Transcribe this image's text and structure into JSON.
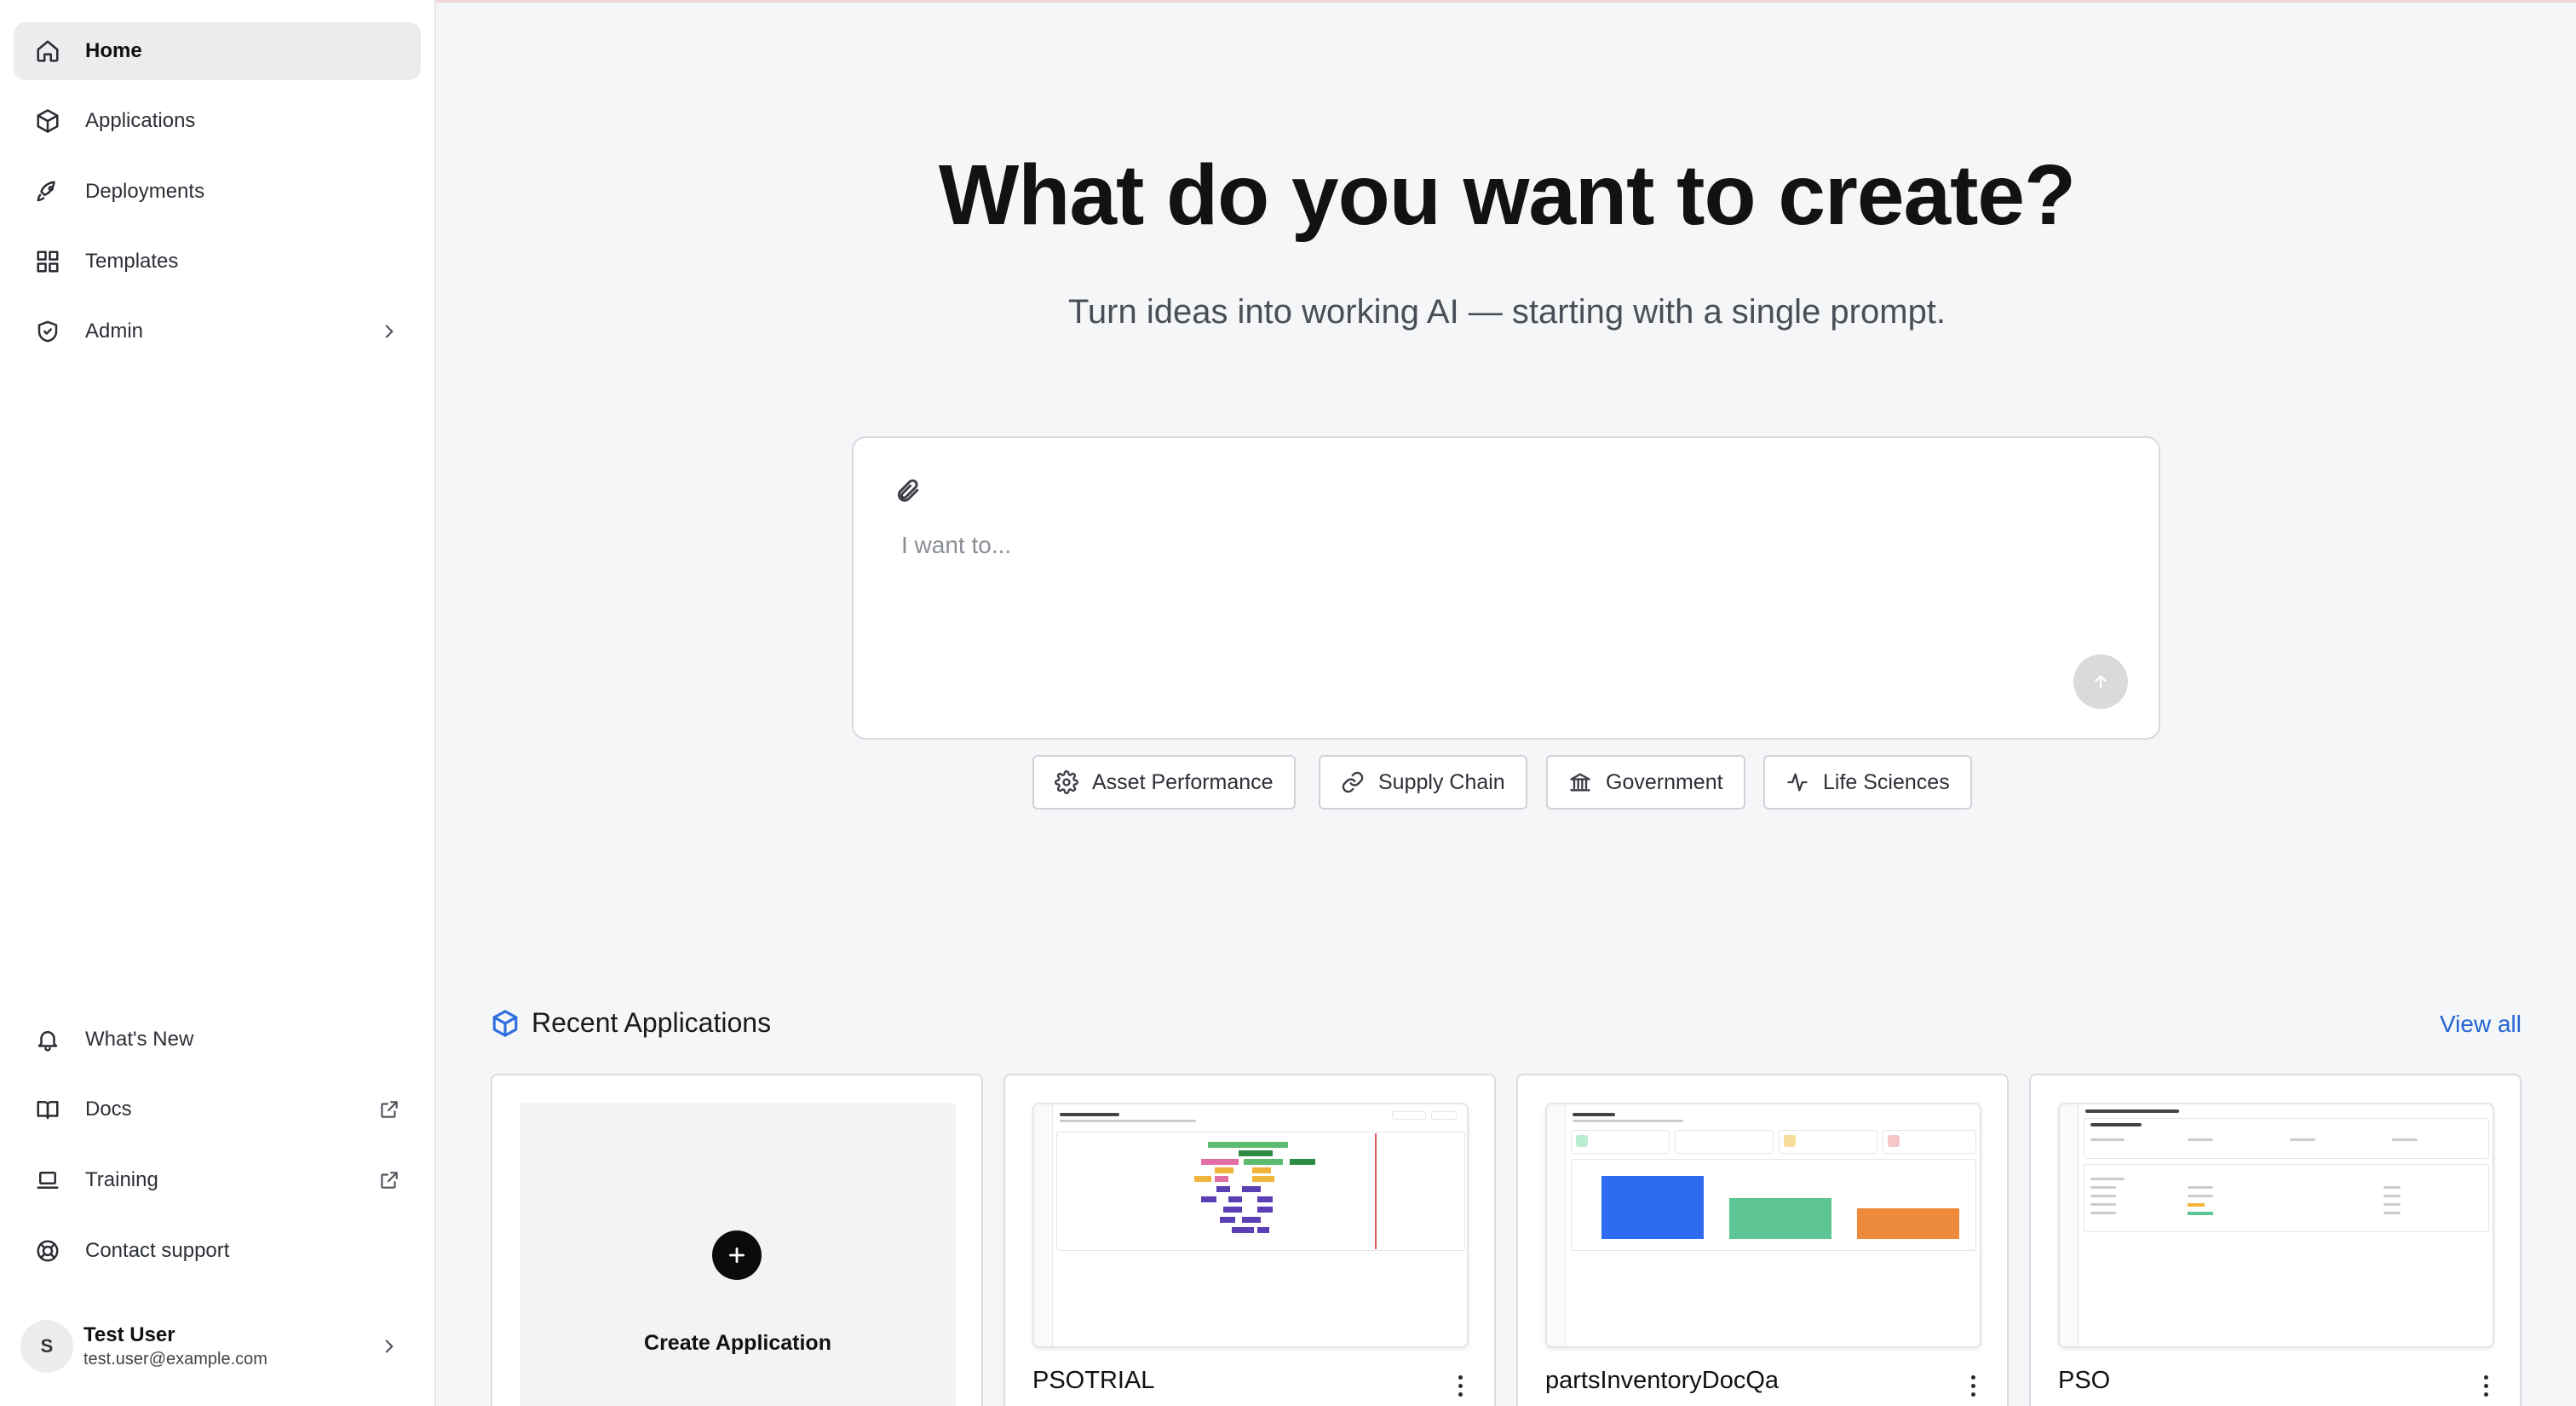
{
  "sidebar": {
    "nav": [
      {
        "label": "Home",
        "icon": "home-icon",
        "active": true
      },
      {
        "label": "Applications",
        "icon": "cube-icon"
      },
      {
        "label": "Deployments",
        "icon": "rocket-icon"
      },
      {
        "label": "Templates",
        "icon": "grid-icon"
      },
      {
        "label": "Admin",
        "icon": "shield-icon"
      }
    ],
    "bottom": [
      {
        "label": "What's New",
        "icon": "bell-icon"
      },
      {
        "label": "Docs",
        "icon": "book-icon"
      },
      {
        "label": "Training",
        "icon": "laptop-icon"
      },
      {
        "label": "Contact support",
        "icon": "lifebuoy-icon"
      }
    ],
    "user": {
      "initial": "S",
      "name": "Test User",
      "email": "test.user@example.com"
    }
  },
  "hero": {
    "title": "What do you want to create?",
    "subtitle": "Turn ideas into working AI — starting with a single prompt."
  },
  "prompt": {
    "placeholder": "I want to...",
    "value": ""
  },
  "chips": [
    {
      "label": "Asset Performance",
      "icon": "gear-icon"
    },
    {
      "label": "Supply Chain",
      "icon": "link-icon"
    },
    {
      "label": "Government",
      "icon": "bank-icon"
    },
    {
      "label": "Life Sciences",
      "icon": "sparkle-icon"
    }
  ],
  "recent": {
    "title": "Recent Applications",
    "view_all": "View all",
    "create_label": "Create Application",
    "apps": [
      {
        "name": "PSOTRIAL"
      },
      {
        "name": "partsInventoryDocQa"
      },
      {
        "name": "PSO"
      }
    ]
  },
  "colors": {
    "accent": "#2364d2",
    "active_bg": "#ebecee",
    "bar_blue": "#2f6bf0",
    "bar_green": "#5cc593",
    "bar_orange": "#ee8a3c"
  }
}
